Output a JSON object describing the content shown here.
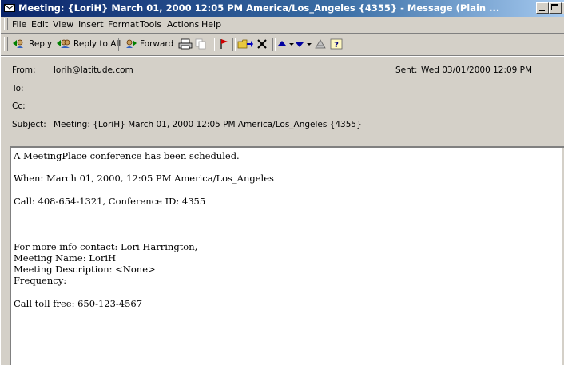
{
  "window": {
    "title": "Meeting: {LoriH} March 01, 2000 12:05 PM America/Los_Angeles {4355} - Message (Plain ..."
  },
  "menu": [
    {
      "label": "File"
    },
    {
      "label": "Edit"
    },
    {
      "label": "View"
    },
    {
      "label": "Insert"
    },
    {
      "label": "Format"
    },
    {
      "label": "Tools"
    },
    {
      "label": "Actions"
    },
    {
      "label": "Help"
    }
  ],
  "toolbar": {
    "reply": "Reply",
    "reply_all": "Reply to All",
    "forward": "Forward"
  },
  "header": {
    "from_label": "From:",
    "from_value": "lorih@latitude.com",
    "sent_label": "Sent:",
    "sent_value": "Wed 03/01/2000 12:09 PM",
    "to_label": "To:",
    "cc_label": "Cc:",
    "subject_label": "Subject:",
    "subject_value": "Meeting: {LoriH} March 01, 2000 12:05 PM America/Los_Angeles {4355}"
  },
  "body": {
    "line1": "A MeetingPlace conference has been scheduled.",
    "line2": "",
    "line3": "When: March 01, 2000, 12:05 PM America/Los_Angeles",
    "line4": "",
    "line5": "Call: 408-654-1321, Conference ID: 4355",
    "line6": "",
    "line7": "",
    "line8": "",
    "line9": "For more info contact: Lori Harrington,",
    "line10": "Meeting Name: LoriH",
    "line11": "Meeting Description: <None>",
    "line12": "Frequency:",
    "line13": "",
    "line14": "Call toll free: 650-123-4567"
  }
}
